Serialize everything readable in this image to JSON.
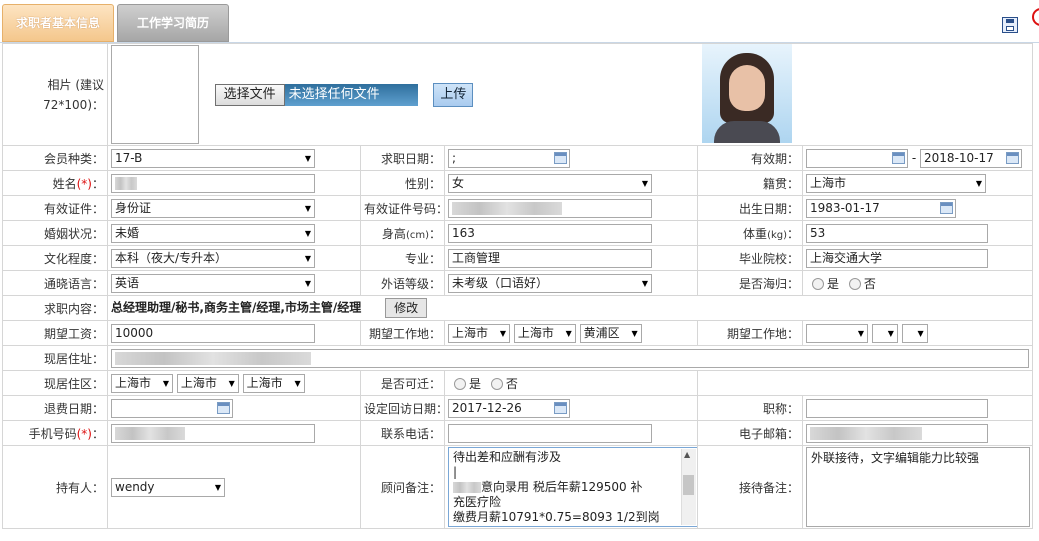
{
  "tabs": [
    {
      "label": "求职者基本信息",
      "active": true
    },
    {
      "label": "工作学习简历",
      "active": false
    }
  ],
  "toolbar": {
    "save_icon": "save-icon",
    "close_icon": "close-icon"
  },
  "photo": {
    "label_line1": "相片 (建议",
    "label_line2": "72*100)：",
    "choose_button": "选择文件",
    "no_file": "未选择任何文件",
    "upload_button": "上传"
  },
  "fields": {
    "member_type_label": "会员种类：",
    "member_type": "17-B",
    "job_date_label": "求职日期：",
    "job_date": ";",
    "valid_period_label": "有效期：",
    "valid_period_end": "2018-10-17",
    "valid_sep": "-",
    "name_label": "姓名",
    "name_suffix": "：",
    "gender_label": "性别：",
    "gender": "女",
    "native_label": "籍贯：",
    "native": "上海市",
    "id_type_label": "有效证件：",
    "id_type": "身份证",
    "id_no_label": "有效证件号码：",
    "birth_label": "出生日期：",
    "birth": "1983-01-17",
    "marital_label": "婚姻状况：",
    "marital": "未婚",
    "height_label": "身高",
    "height_unit": "(cm)",
    "height_colon": "：",
    "height": "163",
    "weight_label": "体重",
    "weight_unit": "(kg)",
    "weight_colon": "：",
    "weight": "53",
    "education_label": "文化程度：",
    "education": "本科（夜大/专升本）",
    "major_label": "专业：",
    "major": "工商管理",
    "school_label": "毕业院校：",
    "school": "上海交通大学",
    "language_label": "通晓语言：",
    "language": "英语",
    "foreign_level_label": "外语等级：",
    "foreign_level": "未考级（口语好）",
    "returnee_label": "是否海归：",
    "yes": "是",
    "no": "否",
    "job_content_label": "求职内容：",
    "job_content": "总经理助理/秘书,商务主管/经理,市场主管/经理",
    "modify_button": "修改",
    "salary_label": "期望工资：",
    "salary": "10000",
    "work_place_label": "期望工作地：",
    "work_place": [
      "上海市",
      "上海市",
      "黄浦区"
    ],
    "work_place2_label": "期望工作地：",
    "address_label": "现居住址：",
    "area_label": "现居住区：",
    "area": [
      "上海市",
      "上海市",
      "上海市"
    ],
    "relocate_label": "是否可迁：",
    "refund_label": "退费日期：",
    "visit_label": "设定回访日期：",
    "visit": "2017-12-26",
    "title_label": "职称：",
    "mobile_label": "手机号码",
    "phone_label": "联系电话：",
    "email_label": "电子邮箱：",
    "holder_label": "持有人：",
    "holder": "wendy",
    "advisor_note_label": "顾问备注：",
    "advisor_note_lines": [
      "待出差和应酬有涉及",
      "|",
      "意向录用 税后年薪129500  补",
      "充医疗险",
      "缴费月薪10791*0.75=8093 1/2到岗"
    ],
    "reception_note_label": "接待备注：",
    "reception_note": "外联接待，文字编辑能力比较强"
  }
}
